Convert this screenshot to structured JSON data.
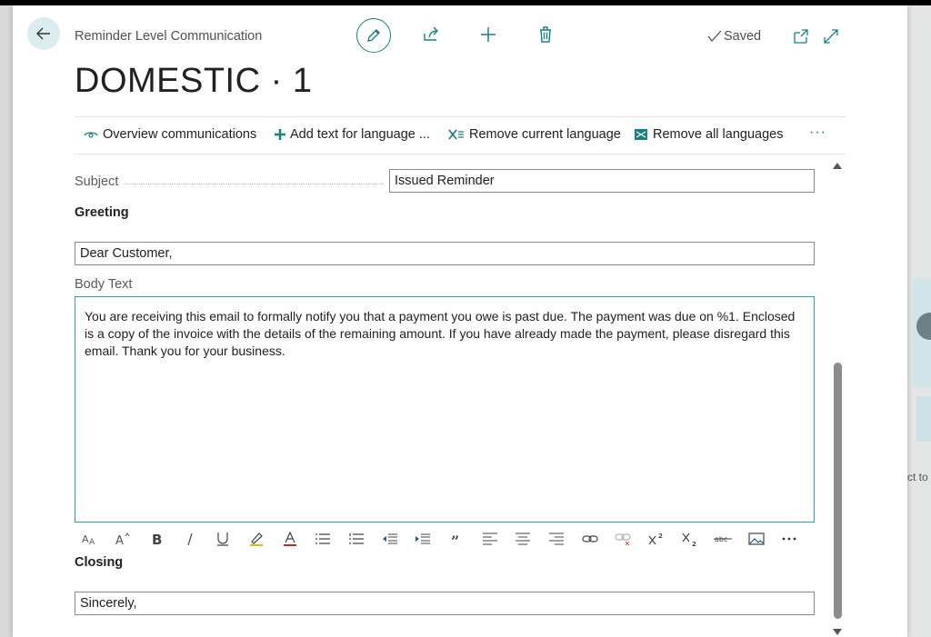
{
  "header": {
    "breadcrumb": "Reminder Level Communication",
    "title": "DOMESTIC · 1",
    "saved_label": "Saved"
  },
  "icons": {
    "back": "arrow-left-icon",
    "edit": "pencil-icon",
    "share": "share-icon",
    "new": "plus-icon",
    "delete": "trash-icon",
    "open_new_window": "open-in-new-window-icon",
    "expand": "expand-icon"
  },
  "toolbar": {
    "items": [
      {
        "label": "Overview communications",
        "icon": "eye-icon"
      },
      {
        "label": "Add text for language ...",
        "icon": "plus-icon"
      },
      {
        "label": "Remove current language",
        "icon": "remove-x-icon"
      },
      {
        "label": "Remove all languages",
        "icon": "remove-all-icon"
      }
    ],
    "more": "···"
  },
  "form": {
    "subject_label": "Subject",
    "subject_value": "Issued Reminder",
    "greeting_label": "Greeting",
    "greeting_value": "Dear Customer,",
    "body_label": "Body Text",
    "body_value": "You are receiving this email to formally notify you that a payment you owe is past due. The payment was due on %1. Enclosed is a copy of the invoice with the details of the remaining amount. If you have already made the payment, please disregard this email. Thank you for your business.",
    "closing_label": "Closing",
    "closing_value": "Sincerely,"
  },
  "editor_toolbar": [
    "font-size-icon",
    "font-grow-icon",
    "bold-icon",
    "italic-icon",
    "underline-icon",
    "highlight-icon",
    "font-color-icon",
    "bullet-list-icon",
    "numbered-list-icon",
    "decrease-indent-icon",
    "increase-indent-icon",
    "quote-icon",
    "align-left-icon",
    "align-center-icon",
    "align-right-icon",
    "link-icon",
    "unlink-icon",
    "superscript-icon",
    "subscript-icon",
    "strikethrough-icon",
    "image-icon",
    "more-icon"
  ],
  "colors": {
    "accent": "#1a8181",
    "body_border": "#2aa5a0",
    "text": "#212121",
    "muted": "#5a5a5a"
  },
  "background_snippet": "ct to"
}
